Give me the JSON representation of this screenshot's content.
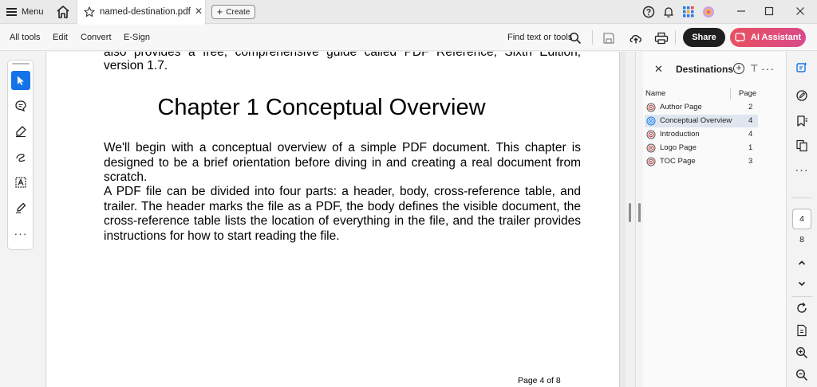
{
  "titlebar": {
    "menu_label": "Menu",
    "tab_title": "named-destination.pdf",
    "tab_close": "✕",
    "create_label": "Create"
  },
  "toolbar": {
    "items": [
      "All tools",
      "Edit",
      "Convert",
      "E-Sign"
    ],
    "find_label": "Find text or tools",
    "share_label": "Share",
    "ai_label": "AI Assistant",
    "ai_color": "#e85060"
  },
  "document": {
    "top_text": "also provides a free, comprehensive guide called PDF Reference, Sixth Edition, version 1.7.",
    "chapter_heading": "Chapter 1 Conceptual Overview",
    "paragraph_1": "We'll begin with a conceptual overview of a simple PDF document. This chapter is designed to be a brief orientation before diving in and creating a real document from scratch.",
    "paragraph_2": "A PDF file can be divided into four parts: a header, body, cross-reference table, and trailer. The header marks the file as a PDF, the body defines the visible document, the cross-reference table lists the location of everything in the file, and the trailer provides instructions for how to start reading the file.",
    "page_footer": "Page 4 of 8"
  },
  "destinations": {
    "title": "Destinations",
    "col_name": "Name",
    "col_page": "Page",
    "rows": [
      {
        "name": "Author Page",
        "page": "2"
      },
      {
        "name": "Conceptual Overview",
        "page": "4"
      },
      {
        "name": "Introduction",
        "page": "4"
      },
      {
        "name": "Logo Page",
        "page": "1"
      },
      {
        "name": "TOC Page",
        "page": "3"
      }
    ],
    "selected_index": 1
  },
  "navigation": {
    "current_page": "4",
    "total_pages": "8"
  },
  "colors": {
    "accent": "#1473e6",
    "share_bg": "#1f1f1f"
  }
}
